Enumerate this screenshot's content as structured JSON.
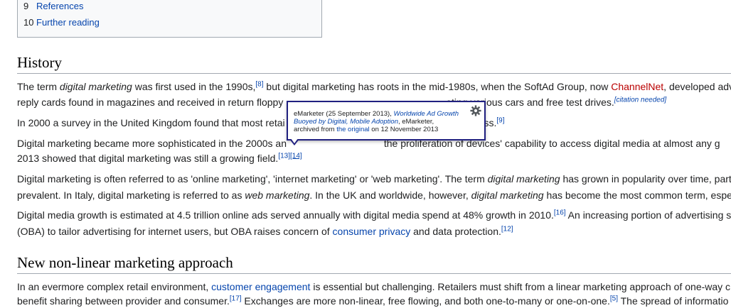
{
  "toc": {
    "items": [
      {
        "num": "9",
        "label": "References"
      },
      {
        "num": "10",
        "label": "Further reading"
      }
    ]
  },
  "history": {
    "heading": "History",
    "p1": {
      "a": "The term ",
      "em1": "digital marketing",
      "b": " was first used in the 1990s,",
      "ref1": "[8]",
      "c": " but digital marketing has roots in the mid-1980s, when the SoftAd Group, now ",
      "link": "ChannelNet",
      "d": ", developed adv",
      "line2a": "reply cards found in magazines and received in return floppy ",
      "line2b": "oting various cars and free test drives.",
      "cn": "[citation needed]"
    },
    "p2": {
      "a": "In 2000 a survey in the United Kingdom found that most retai",
      "b": "ess.",
      "ref": "[9]"
    },
    "p3": {
      "a": "Digital marketing became more sophisticated in the 2000s an",
      "b": " the proliferation of devices' capability to access digital media at almost any g",
      "line2": "2013 showed that digital marketing was still a growing field.",
      "ref1": "[13]",
      "ref2": "[14]"
    },
    "p4": {
      "a": "Digital marketing is often referred to as 'online marketing', 'internet marketing' or 'web marketing'. The term ",
      "em1": "digital marketing",
      "b": " has grown in popularity over time, part",
      "line2a": "prevalent. In Italy, digital marketing is referred to as ",
      "em2": "web marketing",
      "line2b": ". In the UK and worldwide, however, ",
      "em3": "digital marketing",
      "line2c": " has become the most common term, espe"
    },
    "p5": {
      "a": "Digital media growth is estimated at 4.5 trillion online ads served annually with digital media spend at 48% growth in 2010.",
      "ref1": "[16]",
      "b": " An increasing portion of advertising s",
      "line2a": "(OBA) to tailor advertising for internet users, but OBA raises concern of ",
      "link": "consumer privacy",
      "line2b": " and data protection.",
      "ref2": "[12]"
    }
  },
  "section2": {
    "heading": "New non-linear marketing approach",
    "p1": {
      "a": "In an evermore complex retail environment, ",
      "link": "customer engagement",
      "b": " is essential but challenging. Retailers must shift from a linear marketing approach of one-way c",
      "line2a": "benefit sharing between provider and consumer.",
      "ref1": "[17]",
      "line2b": " Exchanges are more non-linear, free flowing, and both one-to-many or one-on-one.",
      "ref2": "[5]",
      "line2c": " The spread of informatio"
    }
  },
  "tooltip": {
    "a": "eMarketer (25 September 2013), ",
    "title": "Worldwide Ad Growth Buoyed by Digital, Mobile Adoption",
    "b": ", eMarketer,",
    "c": "archived from ",
    "link": "the original",
    "d": " on 12 November 2013"
  }
}
